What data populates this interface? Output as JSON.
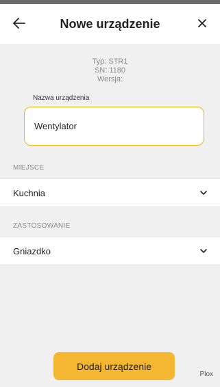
{
  "header": {
    "title": "Nowe urządzenie",
    "back_icon": "arrow-left-icon",
    "close_icon": "close-icon"
  },
  "device_info": {
    "type": "Typ: STR1",
    "serial": "SN: 1180",
    "version": "Wersja:"
  },
  "name_field": {
    "label": "Nazwa urządzenia",
    "value": "Wentylator"
  },
  "place": {
    "label": "MIEJSCE",
    "value": "Kuchnia"
  },
  "usage": {
    "label": "ZASTOSOWANIE",
    "value": "Gniazdko"
  },
  "footer": {
    "add_button": "Dodaj urządzenie",
    "brand": "Plox"
  },
  "colors": {
    "accent": "#f5b731",
    "field_border": "#f4b400",
    "background": "#f0f0f0"
  }
}
